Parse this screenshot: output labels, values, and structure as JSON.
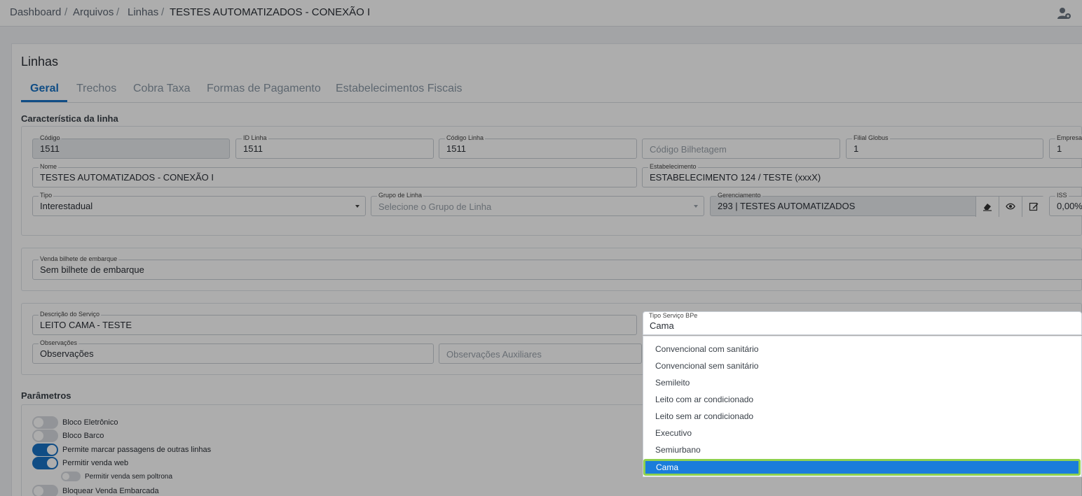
{
  "breadcrumb": {
    "items": [
      "Dashboard",
      "Arquivos",
      "Linhas",
      "TESTES AUTOMATIZADOS - CONEXÃO I"
    ],
    "separator": "/"
  },
  "page": {
    "title": "Linhas"
  },
  "tabs": [
    {
      "label": "Geral",
      "active": true
    },
    {
      "label": "Trechos"
    },
    {
      "label": "Cobra Taxa"
    },
    {
      "label": "Formas de Pagamento"
    },
    {
      "label": "Estabelecimentos Fiscais"
    }
  ],
  "caracteristica": {
    "title": "Característica da linha",
    "codigo": {
      "label": "Código",
      "value": "1511"
    },
    "id_linha": {
      "label": "ID Linha",
      "value": "1511"
    },
    "codigo_linha": {
      "label": "Código Linha",
      "value": "1511"
    },
    "codigo_bilhetagem": {
      "placeholder": "Código Bilhetagem"
    },
    "filial_globus": {
      "label": "Filial Globus",
      "value": "1"
    },
    "empresa": {
      "label": "Empresa",
      "value": "1"
    },
    "nome": {
      "label": "Nome",
      "value": "TESTES AUTOMATIZADOS - CONEXÃO I"
    },
    "estabelecimento": {
      "label": "Estabelecimento",
      "value": "ESTABELECIMENTO 124 / TESTE (xxxX)"
    },
    "tipo": {
      "label": "Tipo",
      "value": "Interestadual"
    },
    "grupo_linha": {
      "label": "Grupo de Linha",
      "placeholder": "Selecione o Grupo de Linha"
    },
    "gerenciamento": {
      "label": "Gerenciamento",
      "value": "293 | TESTES AUTOMATIZADOS"
    },
    "iss": {
      "label": "ISS",
      "value": "0,00%"
    }
  },
  "venda_bilhete": {
    "label": "Venda bilhete de embarque",
    "value": "Sem bilhete de embarque"
  },
  "servico": {
    "descricao": {
      "label": "Descrição do Serviço",
      "value": "LEITO CAMA - TESTE"
    },
    "observacoes": {
      "label": "Observações",
      "value": "Observações"
    },
    "observacoes_aux": {
      "placeholder": "Observações Auxiliares"
    }
  },
  "tipo_servico_bpe": {
    "label": "Tipo Serviço BPe",
    "value": "Cama",
    "options": [
      "Convencional com sanitário",
      "Convencional sem sanitário",
      "Semileito",
      "Leito com ar condicionado",
      "Leito sem ar condicionado",
      "Executivo",
      "Semiurbano",
      "Cama"
    ],
    "selected_index": 7
  },
  "parametros": {
    "title": "Parâmetros",
    "toggles": [
      {
        "label": "Bloco Eletrônico",
        "on": false
      },
      {
        "label": "Bloco Barco",
        "on": false
      },
      {
        "label": "Permite marcar passagens de outras linhas",
        "on": true
      },
      {
        "label": "Permitir venda web",
        "on": true
      },
      {
        "label": "Permitir venda sem poltrona",
        "on": false
      },
      {
        "label": "Bloquear Venda Embarcada",
        "on": false
      }
    ]
  },
  "colors": {
    "accent": "#1872c4",
    "selected_option": "#1a7ddb",
    "highlight_border": "#8fd14f"
  }
}
